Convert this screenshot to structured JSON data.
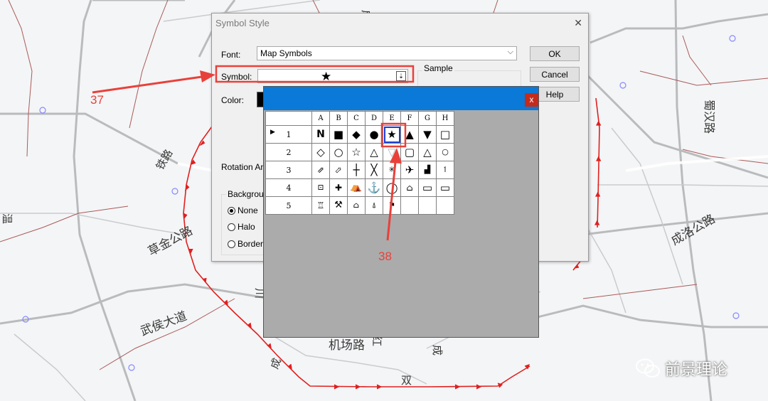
{
  "map_labels": [
    "成",
    "铁路",
    "草金公路",
    "武侯大道",
    "机场路",
    "成洛公路",
    "蜀汉路",
    "川",
    "成",
    "红",
    "双",
    "温",
    "成"
  ],
  "dialog": {
    "title": "Symbol Style",
    "close_glyph": "✕",
    "font_label": "Font:",
    "font_value": "Map Symbols",
    "symbol_label": "Symbol:",
    "symbol_value": "★",
    "color_label": "Color:",
    "sample_label": "Sample",
    "rotation_label": "Rotation An",
    "background_label": "Backgrou",
    "radio_options": [
      {
        "label": "None",
        "selected": true
      },
      {
        "label": "Halo",
        "selected": false
      },
      {
        "label": "Border",
        "selected": false
      }
    ],
    "buttons": {
      "ok": "OK",
      "cancel": "Cancel",
      "help": "Help"
    }
  },
  "popup": {
    "close_glyph": "x",
    "columns": [
      "A",
      "B",
      "C",
      "D",
      "E",
      "F",
      "G",
      "H"
    ],
    "rows": [
      {
        "label": "1",
        "current": true,
        "cells": [
          "N",
          "■",
          "◆",
          "●",
          "★",
          "▲",
          "▼",
          "□"
        ]
      },
      {
        "label": "2",
        "current": false,
        "cells": [
          "◇",
          "○",
          "☆",
          "△",
          "▽",
          "▢",
          "△",
          "○"
        ]
      },
      {
        "label": "3",
        "current": false,
        "cells": [
          "⇗",
          "⬀",
          "┼",
          "╳",
          "✳",
          "✈",
          "▟",
          "↿"
        ]
      },
      {
        "label": "4",
        "current": false,
        "cells": [
          "⊡",
          "✚",
          "⛺",
          "⚓",
          "◯",
          "⌂",
          "▭",
          "▭"
        ]
      },
      {
        "label": "5",
        "current": false,
        "cells": [
          "♖",
          "⚒",
          "⌂",
          "⍋",
          "⚑",
          "",
          "",
          ""
        ]
      }
    ],
    "selected": {
      "row": 1,
      "col": "E"
    }
  },
  "annotations": {
    "callout_37": "37",
    "callout_38": "38"
  },
  "watermark": {
    "text": "前景理论",
    "icon": "wechat-icon"
  },
  "colors": {
    "annotation": "#e8413b",
    "route": "#e02020",
    "titlebar": "#0a79d8",
    "selection": "#1a3fdb"
  }
}
